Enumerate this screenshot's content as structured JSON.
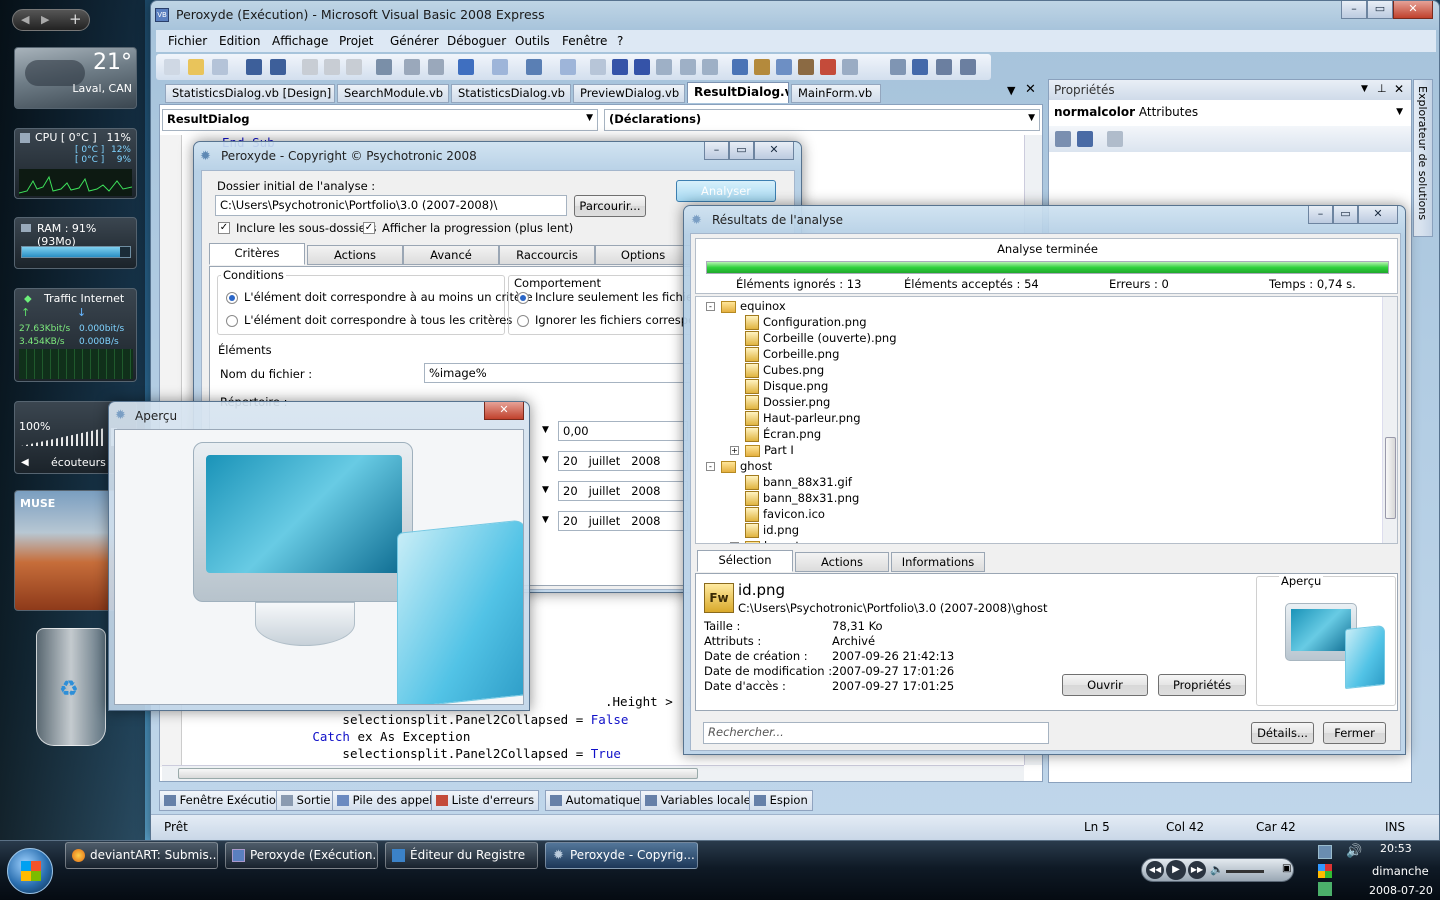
{
  "sidebar": {
    "weather": {
      "temp": "21°",
      "city": "Laval, CAN"
    },
    "cpu": {
      "title": "CPU [ 0°C ]",
      "value": "11%",
      "core1_temp": "[ 0°C ]",
      "core1": "12%",
      "core2_temp": "[ 0°C ]",
      "core2": "9%"
    },
    "ram": {
      "title": "RAM : 91% (93Mo)"
    },
    "traffic": {
      "title": "Traffic Internet",
      "up1": "27.63Kbit/s",
      "down1": "0.000bit/s",
      "up2": "3.454KB/s",
      "down2": "0.000B/s"
    },
    "volume": {
      "level": "100%",
      "device": "écouteurs"
    },
    "album": {
      "text": "MUSE"
    }
  },
  "vb": {
    "title": "Peroxyde (Exécution) - Microsoft Visual Basic 2008 Express",
    "menu": [
      "Fichier",
      "Edition",
      "Affichage",
      "Projet",
      "Générer",
      "Déboguer",
      "Outils",
      "Fenêtre",
      "?"
    ],
    "doc_tabs": [
      "StatisticsDialog.vb [Design]",
      "SearchModule.vb",
      "StatisticsDialog.vb",
      "PreviewDialog.vb",
      "ResultDialog.vb",
      "MainForm.vb"
    ],
    "active_tab": 4,
    "class_combo": "ResultDialog",
    "member_combo": "(Déclarations)",
    "code_top": "End Sub",
    "code_lines": [
      {
        "indent": "                ",
        "kw": "",
        "text": "selectionsplit.Panel2Collapsed = ",
        "val": "False"
      },
      {
        "indent": "            ",
        "kw": "Catch",
        "text": " ex As Exception",
        "val": ""
      },
      {
        "indent": "                ",
        "kw": "",
        "text": "selectionsplit.Panel2Collapsed = ",
        "val": "True"
      }
    ],
    "code_line_partial": ".Height > .Height",
    "properties": {
      "title": "Propriétés",
      "object": "normalcolor",
      "type": "Attributes",
      "side": "Explorateur de solutions"
    },
    "bottom_tabs": [
      "Fenêtre Exécution",
      "Sortie",
      "Pile des appels",
      "Liste d'erreurs",
      "Automatique",
      "Variables locales",
      "Espion"
    ],
    "status": {
      "text": "Prêt",
      "ln": "Ln 5",
      "col": "Col 42",
      "car": "Car 42",
      "mode": "INS"
    }
  },
  "options_dialog": {
    "title": "Peroxyde - Copyright © Psychotronic 2008",
    "folder_label": "Dossier initial de l'analyse :",
    "folder_value": "C:\\Users\\Psychotronic\\Portfolio\\3.0 (2007-2008)\\",
    "browse": "Parcourir...",
    "analyse": "Analyser",
    "include_sub": "Inclure les sous-dossiers",
    "show_progress": "Afficher la progression (plus lent)",
    "tabs": [
      "Critères",
      "Actions",
      "Avancé",
      "Raccourcis",
      "Options"
    ],
    "conditions_title": "Conditions",
    "cond1": "L'élément doit correspondre à au moins un critère",
    "cond2": "L'élément doit correspondre à tous les critères",
    "behavior_title": "Comportement",
    "beh1": "Inclure seulement les fichiers corr",
    "beh2": "Ignorer les fichiers correspondant",
    "elements_title": "Éléments",
    "name_label": "Nom du fichier :",
    "name_value": "%image%",
    "dir_label": "Répertoire :",
    "size_value": "0,00",
    "dates": [
      {
        "d": "20",
        "m": "juillet",
        "y": "2008"
      },
      {
        "d": "20",
        "m": "juillet",
        "y": "2008"
      },
      {
        "d": "20",
        "m": "juillet",
        "y": "2008"
      }
    ]
  },
  "preview_dialog": {
    "title": "Aperçu"
  },
  "results": {
    "title": "Résultats de l'analyse",
    "status": "Analyse terminée",
    "progress": 1.0,
    "ignored": "Éléments ignorés : 13",
    "accepted": "Éléments acceptés : 54",
    "errors": "Erreurs : 0",
    "time": "Temps : 0,74 s.",
    "tree": [
      {
        "level": 0,
        "type": "folder",
        "label": "equinox",
        "exp": "-"
      },
      {
        "level": 1,
        "type": "file",
        "label": "Configuration.png"
      },
      {
        "level": 1,
        "type": "file",
        "label": "Corbeille (ouverte).png"
      },
      {
        "level": 1,
        "type": "file",
        "label": "Corbeille.png"
      },
      {
        "level": 1,
        "type": "file",
        "label": "Cubes.png"
      },
      {
        "level": 1,
        "type": "file",
        "label": "Disque.png"
      },
      {
        "level": 1,
        "type": "file",
        "label": "Dossier.png"
      },
      {
        "level": 1,
        "type": "file",
        "label": "Haut-parleur.png"
      },
      {
        "level": 1,
        "type": "file",
        "label": "Écran.png"
      },
      {
        "level": 1,
        "type": "folder",
        "label": "Part I",
        "exp": "+"
      },
      {
        "level": 0,
        "type": "folder",
        "label": "ghost",
        "exp": "-"
      },
      {
        "level": 1,
        "type": "file",
        "label": "bann_88x31.gif"
      },
      {
        "level": 1,
        "type": "file",
        "label": "bann_88x31.png"
      },
      {
        "level": 1,
        "type": "file",
        "label": "favicon.ico"
      },
      {
        "level": 1,
        "type": "file",
        "label": "id.png"
      },
      {
        "level": 1,
        "type": "folder",
        "label": "layout",
        "exp": "+"
      }
    ],
    "tabs": [
      "Sélection",
      "Actions",
      "Informations"
    ],
    "file_badge": "Fw",
    "file_name": "id.png",
    "file_path": "C:\\Users\\Psychotronic\\Portfolio\\3.0 (2007-2008)\\ghost",
    "props": [
      {
        "k": "Taille :",
        "v": "78,31 Ko"
      },
      {
        "k": "Attributs :",
        "v": "Archivé"
      },
      {
        "k": "Date de création :",
        "v": "2007-09-26 21:42:13"
      },
      {
        "k": "Date de modification :",
        "v": "2007-09-27 17:01:26"
      },
      {
        "k": "Date d'accès :",
        "v": "2007-09-27 17:01:25"
      }
    ],
    "preview_label": "Aperçu",
    "open": "Ouvrir",
    "properties": "Propriétés",
    "search_placeholder": "Rechercher...",
    "details": "Détails...",
    "close": "Fermer"
  },
  "taskbar": {
    "items": [
      "deviantART: Submis...",
      "Peroxyde (Exécution...",
      "Éditeur du Registre",
      "Peroxyde - Copyrig..."
    ],
    "active": 3,
    "time": "20:53",
    "day": "dimanche",
    "date": "2008-07-20"
  },
  "colors": {
    "progress": "#2fd13c",
    "keyword": "#1010c8",
    "taskbar": "#0b1a2a"
  }
}
